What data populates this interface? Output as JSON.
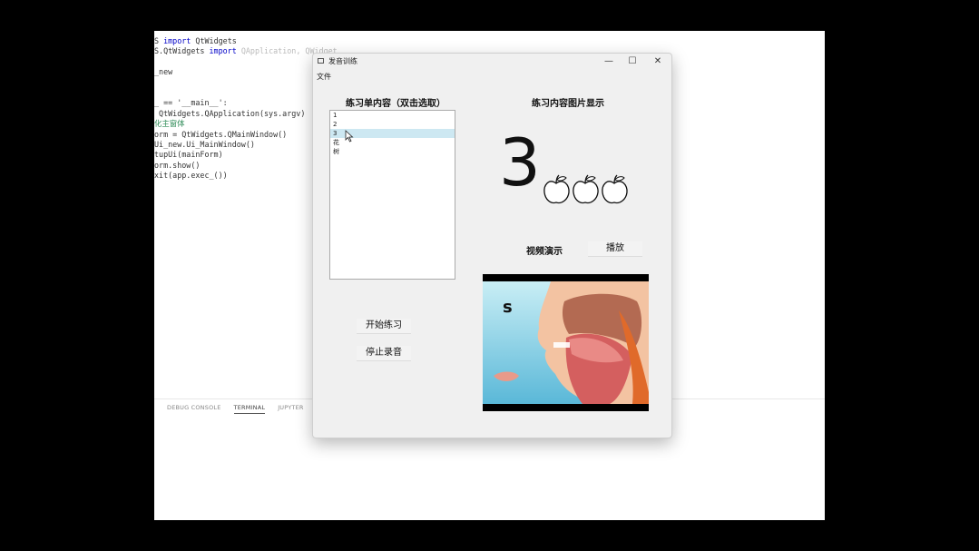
{
  "editor": {
    "code_lines": [
      {
        "parts": [
          {
            "t": "S ",
            "c": ""
          },
          {
            "t": "import",
            "c": "kw"
          },
          {
            "t": " QtWidgets",
            "c": ""
          }
        ]
      },
      {
        "parts": [
          {
            "t": "S.QtWidgets ",
            "c": ""
          },
          {
            "t": "import",
            "c": "kw"
          },
          {
            "t": " QApplication, QWidget",
            "c": "faded"
          }
        ]
      },
      {
        "parts": [
          {
            "t": "",
            "c": ""
          }
        ]
      },
      {
        "parts": [
          {
            "t": "_new",
            "c": ""
          }
        ]
      },
      {
        "parts": [
          {
            "t": "",
            "c": ""
          }
        ]
      },
      {
        "parts": [
          {
            "t": "",
            "c": ""
          }
        ]
      },
      {
        "parts": [
          {
            "t": "_ == '__main__':",
            "c": ""
          }
        ]
      },
      {
        "parts": [
          {
            "t": " QtWidgets.QApplication(sys.argv)",
            "c": ""
          }
        ]
      },
      {
        "parts": [
          {
            "t": "化主窗体",
            "c": "cm"
          }
        ]
      },
      {
        "parts": [
          {
            "t": "orm = QtWidgets.QMainWindow()",
            "c": ""
          }
        ]
      },
      {
        "parts": [
          {
            "t": "Ui_new.Ui_MainWindow()",
            "c": ""
          }
        ]
      },
      {
        "parts": [
          {
            "t": "tupUi(mainForm)",
            "c": ""
          }
        ]
      },
      {
        "parts": [
          {
            "t": "orm.show()",
            "c": ""
          }
        ]
      },
      {
        "parts": [
          {
            "t": "xit(app.exec_())",
            "c": ""
          }
        ]
      }
    ],
    "panel_tabs": [
      "DEBUG CONSOLE",
      "TERMINAL",
      "JUPYTER"
    ],
    "active_tab": "TERMINAL"
  },
  "window": {
    "title": "发音训练",
    "controls": {
      "minimize": "—",
      "maximize": "☐",
      "close": "✕"
    },
    "menu": [
      "文件"
    ],
    "list_label": "练习单内容（双击选取）",
    "list_items": [
      "1",
      "2",
      "3",
      "花",
      "树"
    ],
    "selected_index": 2,
    "image_label": "练习内容图片显示",
    "display_digit": "3",
    "apple_count": 3,
    "video_label": "视频演示",
    "play_button": "播放",
    "start_button": "开始练习",
    "stop_button": "停止录音",
    "video_letter": "s"
  }
}
